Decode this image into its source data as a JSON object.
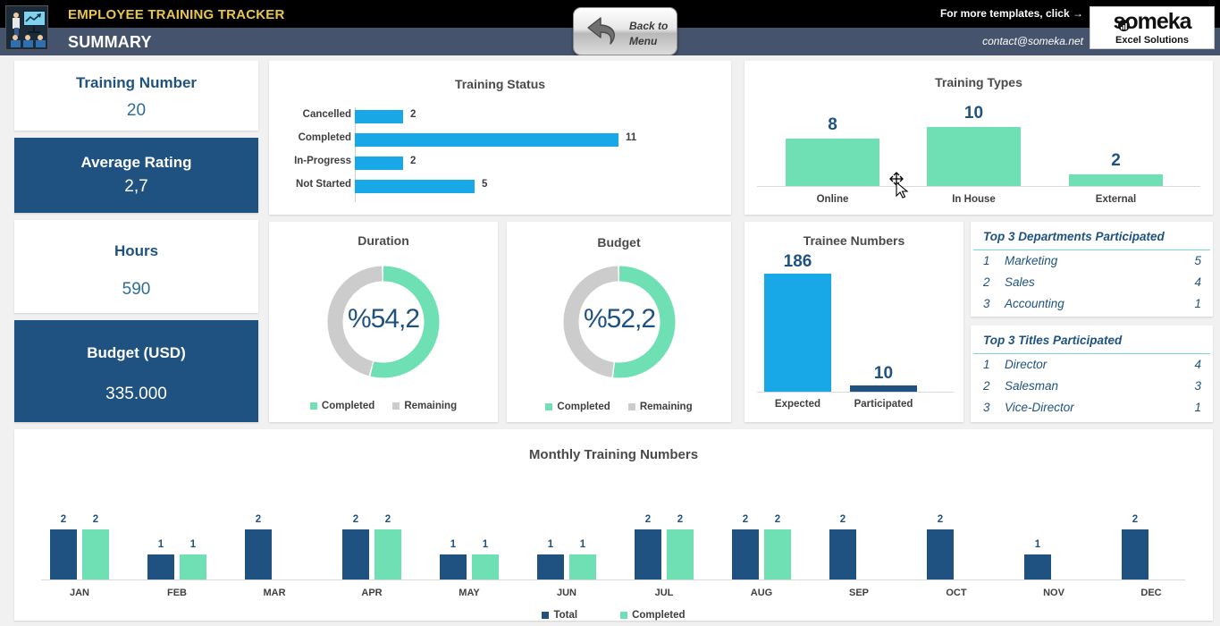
{
  "header": {
    "app_title": "EMPLOYEE TRAINING TRACKER",
    "page_title": "SUMMARY",
    "templates_text": "For more templates, click →",
    "contact_email": "contact@someka.net",
    "back_button_line1": "Back to",
    "back_button_line2": "Menu",
    "brand_name": "someka",
    "brand_tagline": "Excel Solutions"
  },
  "kpis": [
    {
      "title": "Training Number",
      "value": "20",
      "style": "light"
    },
    {
      "title": "Average Rating",
      "value": "2,7",
      "style": "dark"
    },
    {
      "title": "Hours",
      "value": "590",
      "style": "light"
    },
    {
      "title": "Budget (USD)",
      "value": "335.000",
      "style": "dark"
    }
  ],
  "colors": {
    "navy": "#1F5280",
    "cyan": "#18A8E8",
    "green": "#6FE0B4",
    "gray": "#CCCCCC",
    "header_black": "#000000",
    "header_blue": "#45546C",
    "accent_yellow": "#E8C54B",
    "page_bg": "#F1F1F1"
  },
  "chart_data": [
    {
      "id": "training-status",
      "type": "bar",
      "orientation": "horizontal",
      "title": "Training Status",
      "categories": [
        "Cancelled",
        "Completed",
        "In-Progress",
        "Not Started"
      ],
      "values": [
        2,
        11,
        2,
        5
      ],
      "series_color": "#18A8E8",
      "xlim": [
        0,
        11
      ],
      "grid": false,
      "data_labels": true
    },
    {
      "id": "training-types",
      "type": "bar",
      "orientation": "vertical",
      "title": "Training Types",
      "categories": [
        "Online",
        "In House",
        "External"
      ],
      "values": [
        8,
        10,
        2
      ],
      "series_color": "#6FE0B4",
      "ylim": [
        0,
        10
      ],
      "grid": false,
      "data_labels": true
    },
    {
      "id": "duration-donut",
      "type": "pie",
      "subtype": "donut",
      "title": "Duration",
      "center_label": "%54,2",
      "labels": [
        "Completed",
        "Remaining"
      ],
      "values": [
        54.2,
        45.8
      ],
      "slice_colors": [
        "#6FE0B4",
        "#CCCCCC"
      ],
      "legend_position": "bottom"
    },
    {
      "id": "budget-donut",
      "type": "pie",
      "subtype": "donut",
      "title": "Budget",
      "center_label": "%52,2",
      "labels": [
        "Completed",
        "Remaining"
      ],
      "values": [
        52.2,
        47.8
      ],
      "slice_colors": [
        "#6FE0B4",
        "#CCCCCC"
      ],
      "legend_position": "bottom"
    },
    {
      "id": "trainee-numbers",
      "type": "bar",
      "orientation": "vertical",
      "title": "Trainee Numbers",
      "categories": [
        "Expected",
        "Participated"
      ],
      "values": [
        186,
        10
      ],
      "bar_colors": [
        "#18A8E8",
        "#1F5280"
      ],
      "ylim": [
        0,
        186
      ],
      "grid": false,
      "data_labels": true
    },
    {
      "id": "monthly-training-numbers",
      "type": "bar",
      "orientation": "vertical",
      "title": "Monthly Training Numbers",
      "categories": [
        "JAN",
        "FEB",
        "MAR",
        "APR",
        "MAY",
        "JUN",
        "JUL",
        "AUG",
        "SEP",
        "OCT",
        "NOV",
        "DEC"
      ],
      "series": [
        {
          "name": "Total",
          "color": "#1F5280",
          "values": [
            2,
            1,
            2,
            2,
            1,
            1,
            2,
            2,
            2,
            2,
            1,
            2
          ]
        },
        {
          "name": "Completed",
          "color": "#6FE0B4",
          "values": [
            2,
            1,
            0,
            2,
            1,
            1,
            2,
            2,
            0,
            0,
            0,
            0
          ]
        }
      ],
      "ylim": [
        0,
        2
      ],
      "grid": false,
      "data_labels": true,
      "legend_position": "bottom"
    }
  ],
  "top3": [
    {
      "heading": "Top 3 Departments Participated",
      "rows": [
        {
          "rank": "1",
          "name": "Marketing",
          "value": "5"
        },
        {
          "rank": "2",
          "name": "Sales",
          "value": "4"
        },
        {
          "rank": "3",
          "name": "Accounting",
          "value": "1"
        }
      ]
    },
    {
      "heading": "Top 3 Titles Participated",
      "rows": [
        {
          "rank": "1",
          "name": "Director",
          "value": "4"
        },
        {
          "rank": "2",
          "name": "Salesman",
          "value": "3"
        },
        {
          "rank": "3",
          "name": "Vice-Director",
          "value": "1"
        }
      ]
    }
  ]
}
